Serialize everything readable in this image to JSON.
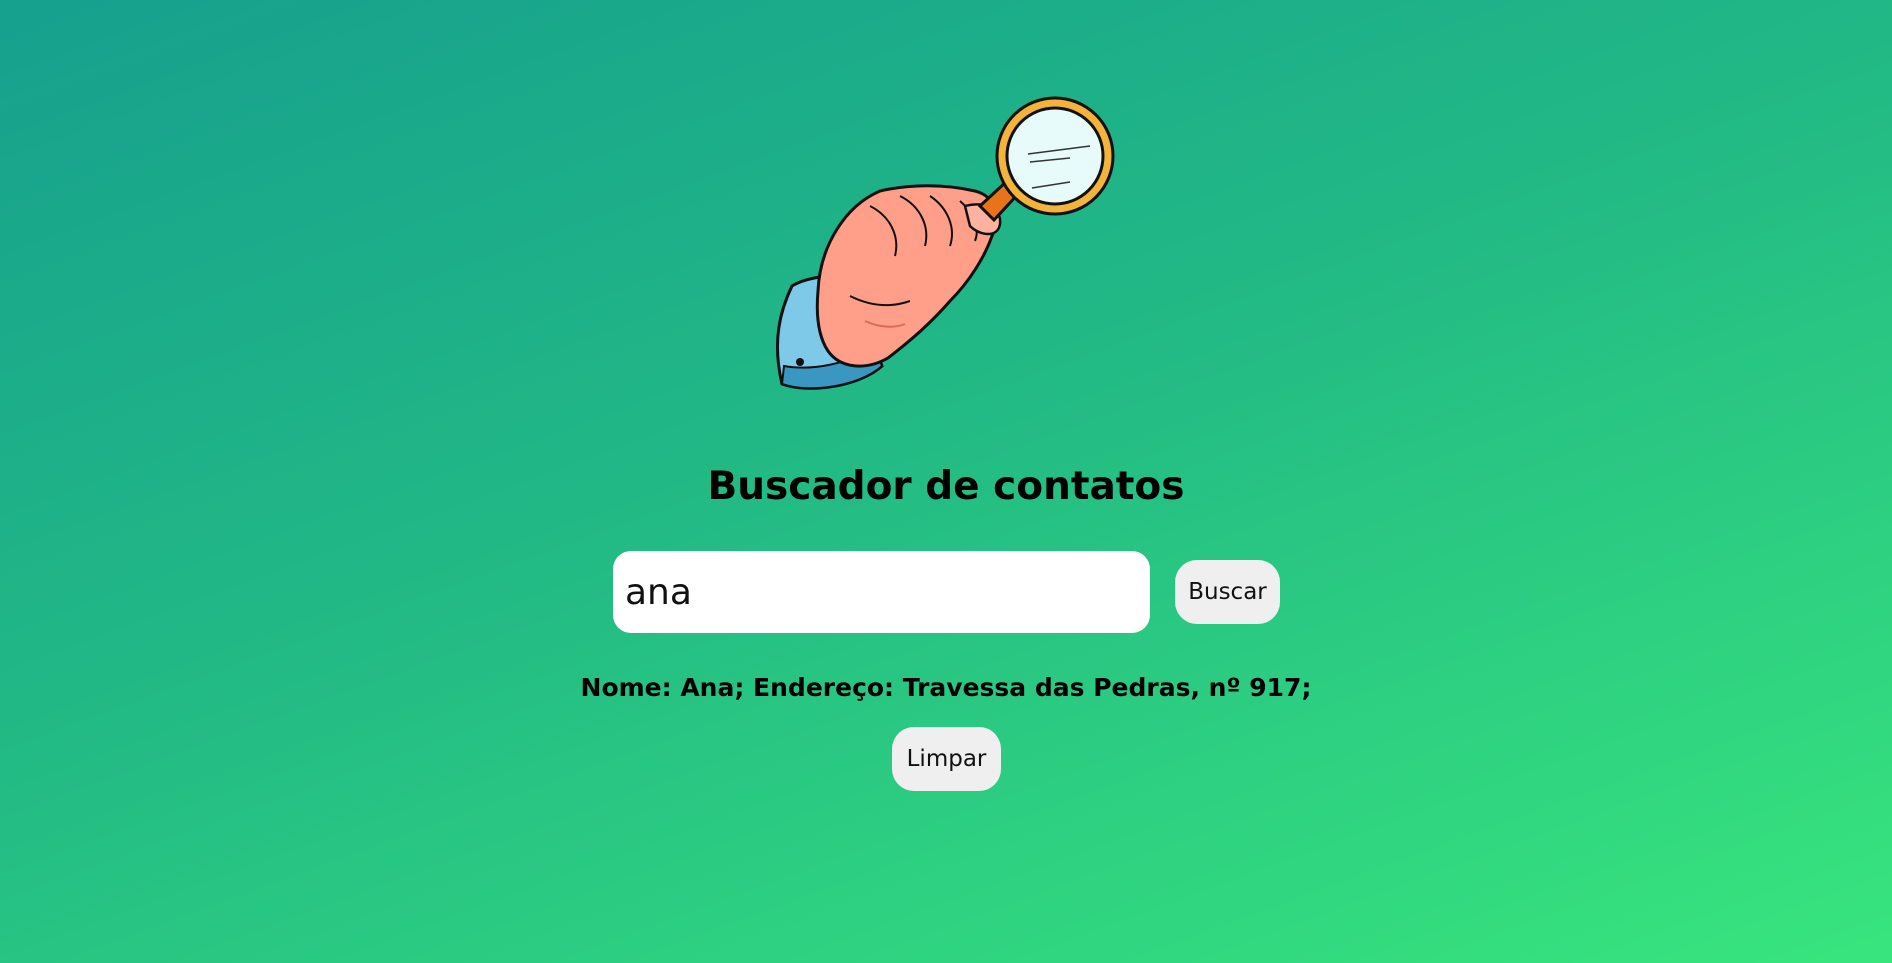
{
  "header": {
    "illustration_icon": "hand-holding-magnifying-glass-icon",
    "title": "Buscador de contatos"
  },
  "search": {
    "value": "ana",
    "button_label": "Buscar"
  },
  "result": {
    "text": "Nome: Ana; Endereço: Travessa das Pedras, nº 917;"
  },
  "actions": {
    "clear_label": "Limpar"
  },
  "colors": {
    "background_start": "#16a08e",
    "background_end": "#38e57d",
    "input_bg": "#ffffff",
    "button_bg": "#efefef"
  }
}
